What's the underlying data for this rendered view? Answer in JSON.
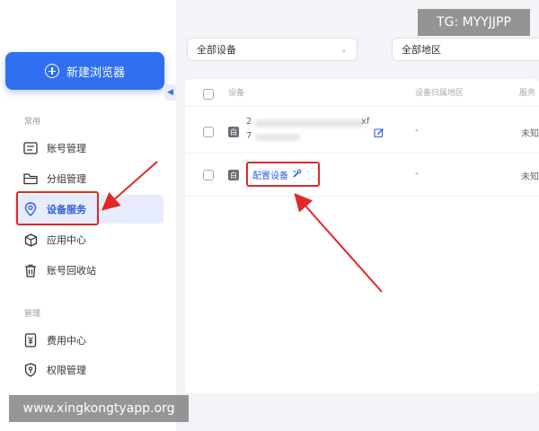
{
  "sidebar": {
    "new_browser_label": "新建浏览器",
    "sections": {
      "common": "常用",
      "manage": "管理"
    },
    "items": [
      {
        "label": "账号管理",
        "icon": "account-list-icon"
      },
      {
        "label": "分组管理",
        "icon": "folder-icon"
      },
      {
        "label": "设备服务",
        "icon": "location-pin-icon",
        "active": true
      },
      {
        "label": "应用中心",
        "icon": "cube-icon"
      },
      {
        "label": "账号回收站",
        "icon": "trash-icon"
      },
      {
        "label": "费用中心",
        "icon": "bill-icon"
      },
      {
        "label": "权限管理",
        "icon": "shield-key-icon"
      }
    ]
  },
  "filters": {
    "device": "全部设备",
    "region": "全部地区"
  },
  "table": {
    "headers": [
      "设备",
      "设备归属地区",
      "服务"
    ],
    "rows": [
      {
        "device": "2",
        "device_extra": "xf",
        "device_line2": "7",
        "region": "-",
        "service": "未知"
      },
      {
        "configure_label": "配置设备",
        "region": "-",
        "service": "未知"
      }
    ]
  },
  "watermarks": {
    "top_right": "TG: MYYJJPP",
    "bottom_left": "www.xingkongtyapp.org"
  },
  "colors": {
    "primary": "#2f6ff0",
    "active_bg": "#e6ecfb",
    "annotation_red": "#e02828"
  }
}
